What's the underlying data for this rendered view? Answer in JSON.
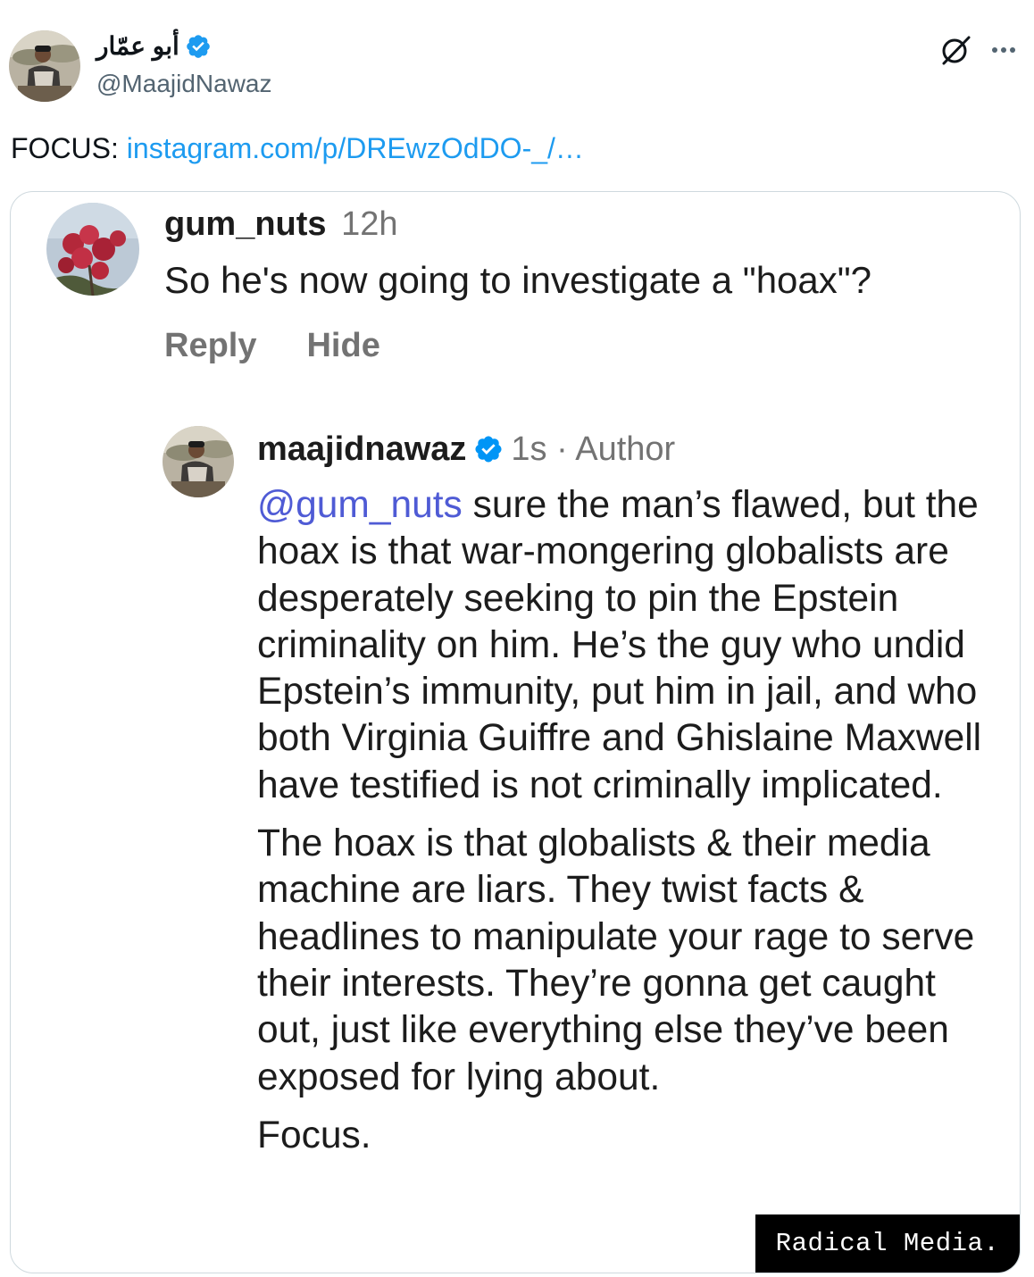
{
  "tweet": {
    "author": {
      "display_name": "أبو عمّار",
      "handle": "@MaajidNawaz",
      "verified": true,
      "verified_color": "#1d9bf0"
    },
    "text_prefix": "FOCUS: ",
    "link_text": "instagram.com/p/DREwzOdDO-_/…",
    "link_color": "#1d9bf0",
    "icons": [
      "avatar",
      "verified-badge-icon",
      "grok-icon",
      "more-icon"
    ]
  },
  "embedded_screenshot": {
    "comment": {
      "username": "gum_nuts",
      "time": "12h",
      "text": "So he's now going to investigate a \"hoax\"?",
      "actions": [
        "Reply",
        "Hide"
      ]
    },
    "reply": {
      "username": "maajidnawaz",
      "verified": true,
      "meta": "1s · Author",
      "mention": "@gum_nuts",
      "paragraph1_rest": " sure the man’s flawed, but the hoax is that war-mongering globalists are desperately seeking to pin the Epstein criminality on him. He’s the guy who undid Epstein’s immunity, put him in jail, and who both Virginia Guiffre and Ghislaine Maxwell have testified is not criminally implicated.",
      "paragraph2": "The hoax is that globalists & their media machine are liars. They twist facts & headlines to manipulate your rage to serve their interests. They’re gonna get caught out, just like everything else they’ve been exposed for lying about.",
      "paragraph3": "Focus."
    },
    "watermark": "Radical Media."
  }
}
